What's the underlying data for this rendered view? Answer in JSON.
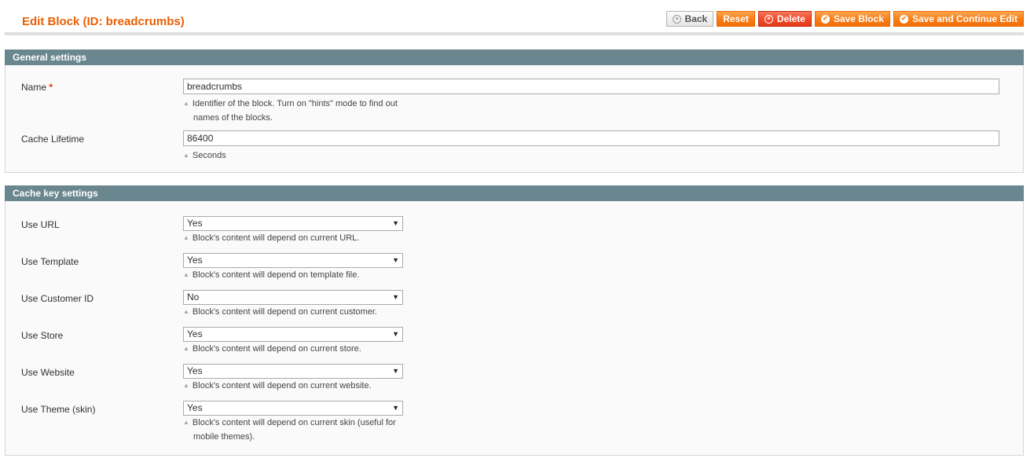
{
  "header": {
    "title": "Edit Block (ID: breadcrumbs)",
    "buttons": {
      "back": "Back",
      "reset": "Reset",
      "delete": "Delete",
      "save": "Save Block",
      "save_continue": "Save and Continue Edit"
    }
  },
  "general": {
    "title": "General settings",
    "name": {
      "label": "Name",
      "required_mark": "*",
      "value": "breadcrumbs",
      "note_line1": "Identifier of the block. Turn on \"hints\" mode to find out",
      "note_line2": "names of the blocks."
    },
    "cache_lifetime": {
      "label": "Cache Lifetime",
      "value": "86400",
      "note": "Seconds"
    }
  },
  "cache_key": {
    "title": "Cache key settings",
    "fields": [
      {
        "label": "Use URL",
        "value": "Yes",
        "note": "Block's content will depend on current URL."
      },
      {
        "label": "Use Template",
        "value": "Yes",
        "note": "Block's content will depend on template file."
      },
      {
        "label": "Use Customer ID",
        "value": "No",
        "note": "Block's content will depend on current customer."
      },
      {
        "label": "Use Store",
        "value": "Yes",
        "note": "Block's content will depend on current store."
      },
      {
        "label": "Use Website",
        "value": "Yes",
        "note": "Block's content will depend on current website."
      },
      {
        "label": "Use Theme (skin)",
        "value": "Yes",
        "note": "Block's content will depend on current skin (useful for",
        "note2": "mobile themes)."
      }
    ]
  },
  "icons": {
    "back": "◂",
    "delete": "×",
    "check": "✔",
    "dropdown": "▼",
    "note": "▲"
  }
}
